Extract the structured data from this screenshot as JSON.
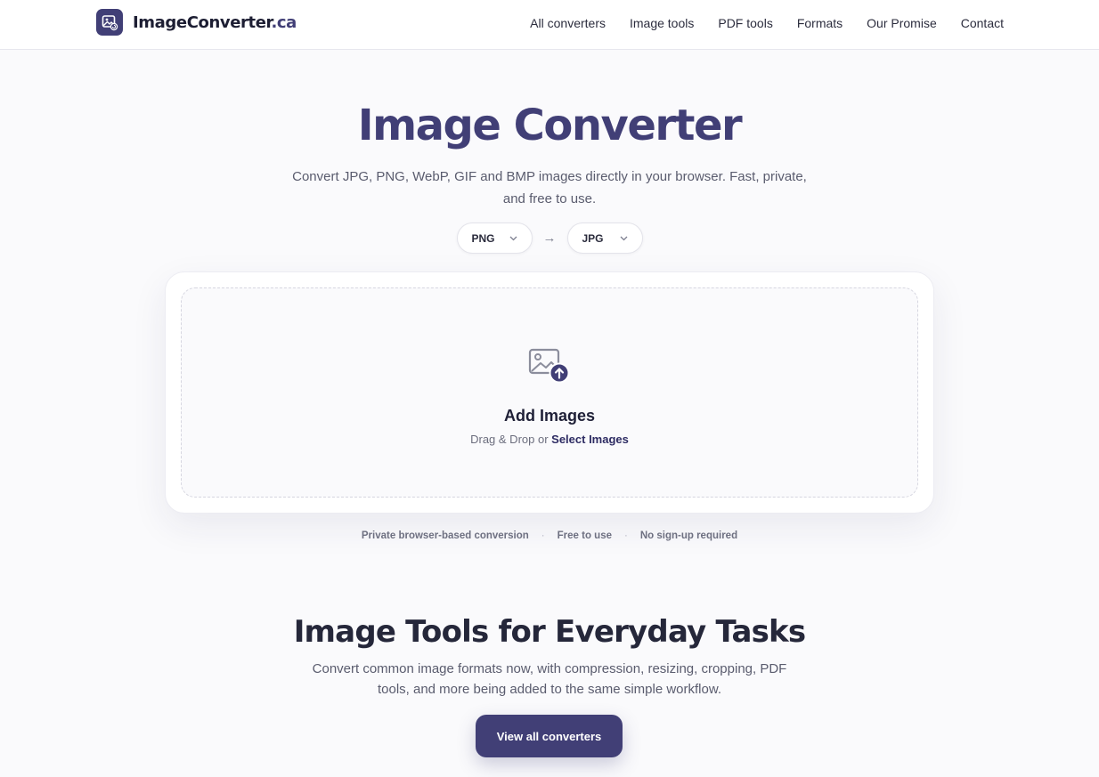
{
  "header": {
    "brand_name": "ImageConverter",
    "brand_tld": ".ca",
    "nav": [
      {
        "label": "All converters"
      },
      {
        "label": "Image tools"
      },
      {
        "label": "PDF tools"
      },
      {
        "label": "Formats"
      },
      {
        "label": "Our Promise"
      },
      {
        "label": "Contact"
      }
    ]
  },
  "hero": {
    "title": "Image Converter",
    "subtitle": "Convert JPG, PNG, WebP, GIF and BMP images directly in your browser. Fast, private, and free to use.",
    "from_format": "PNG",
    "to_format": "JPG",
    "arrow": "→",
    "chevron": "⌄"
  },
  "upload": {
    "title": "Add Images",
    "prompt": "Drag & Drop or",
    "select_label": "Select Images"
  },
  "features": [
    "Private browser-based conversion",
    "Free to use",
    "No sign-up required"
  ],
  "features_separator": "·",
  "section": {
    "title": "Image Tools for Everyday Tasks",
    "subtitle": "Convert common image formats now, with compression, resizing, cropping, PDF tools, and more being added to the same simple workflow.",
    "cta_label": "View all converters"
  },
  "colors": {
    "brand": "#413f76",
    "text": "#1f2037",
    "muted": "#5a5c6e",
    "background": "#fafafc"
  }
}
